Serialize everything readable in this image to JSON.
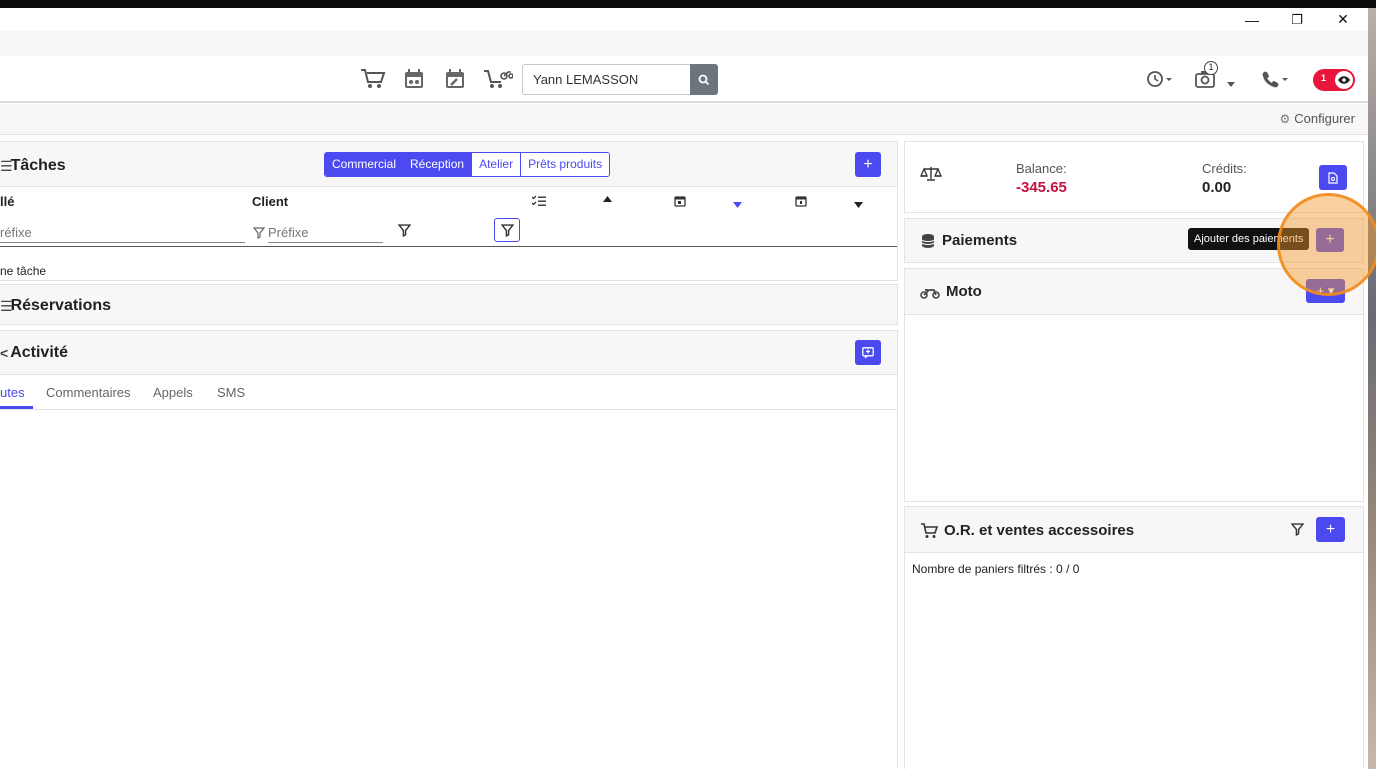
{
  "window": {
    "minimize_glyph": "—",
    "restore_glyph": "❐",
    "close_glyph": "✕"
  },
  "header": {
    "icons": [
      "cart-icon",
      "calendar-moto-icon",
      "calendar-wrench-icon",
      "cart-moto-icon"
    ],
    "search": {
      "value": "Yann LEMASSON",
      "placeholder": ""
    },
    "right_icons": [
      "history-icon",
      "camera-icon",
      "phone-icon"
    ],
    "camera_badge": "1",
    "toggle_label": "1"
  },
  "config": {
    "label": "Configurer"
  },
  "taches": {
    "title": "Tâches",
    "segments": [
      "Commercial",
      "Réception",
      "Atelier",
      "Prêts produits"
    ],
    "active_segments": [
      "Commercial",
      "Réception"
    ],
    "col_libelle": "llé",
    "col_client": "Client",
    "filter_libelle_placeholder": "réfixe",
    "filter_client_placeholder": "Préfixe",
    "empty_text": "ne tâche"
  },
  "reservations": {
    "title": "Réservations"
  },
  "activite": {
    "title": "Activité",
    "tabs": [
      "utes",
      "Commentaires",
      "Appels",
      "SMS"
    ],
    "active_tab": "utes"
  },
  "balance": {
    "balance_label": "Balance:",
    "balance_value": "-345.65",
    "credits_label": "Crédits:",
    "credits_value": "0.00",
    "balance_color": "#c4123e"
  },
  "paiements": {
    "title": "Paiements",
    "tooltip": "Ajouter des paiements"
  },
  "moto": {
    "title": "Moto"
  },
  "or_ventes": {
    "title": "O.R. et ventes accessoires",
    "filter_text": "Nombre de paniers filtrés : 0 / 0"
  },
  "colors": {
    "accent": "#4a4af0",
    "danger": "#e8153c",
    "highlight": "#f0962a"
  }
}
